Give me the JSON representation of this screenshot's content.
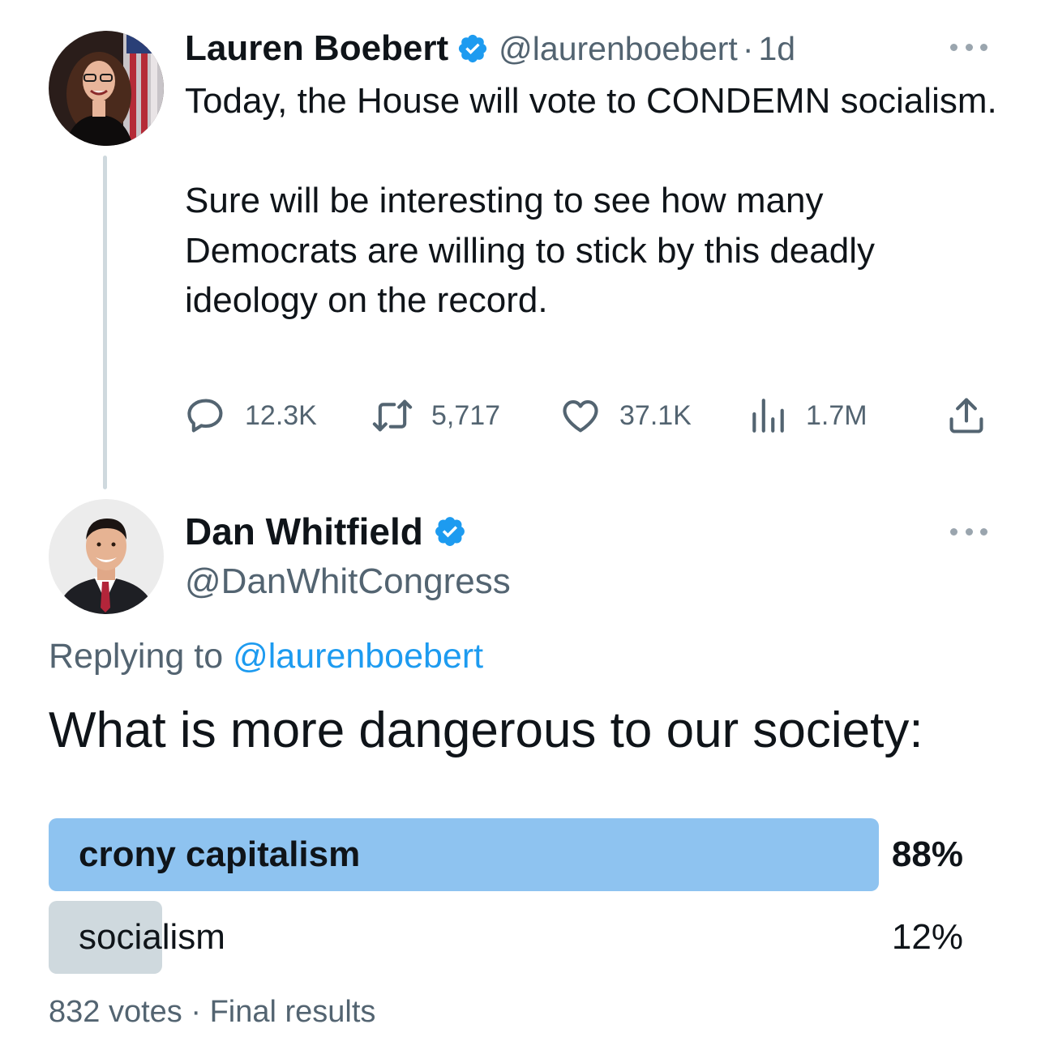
{
  "colors": {
    "verified": "#1d9bf0",
    "secondary_text": "#536471",
    "link": "#1d9bf0",
    "poll_winner": "#8ec3f0",
    "poll_other": "#cfd9de"
  },
  "original_tweet": {
    "author_name": "Lauren Boebert",
    "handle": "@laurenboebert",
    "separator": "·",
    "time": "1d",
    "text_lines": [
      "Today, the House will vote to CONDEMN socialism.",
      "",
      "Sure will be interesting to see how many Democrats are willing to stick by this deadly ideology on the record."
    ],
    "actions": {
      "replies": "12.3K",
      "retweets": "5,717",
      "likes": "37.1K",
      "views": "1.7M"
    },
    "icons": [
      "reply-icon",
      "retweet-icon",
      "like-icon",
      "views-icon",
      "share-icon",
      "more-icon",
      "verified-badge-icon"
    ]
  },
  "reply_tweet": {
    "author_name": "Dan Whitfield",
    "handle": "@DanWhitCongress",
    "replying_prefix": "Replying to ",
    "replying_to": "@laurenboebert",
    "question": "What is more dangerous to our society:",
    "poll": {
      "options": [
        {
          "label": "crony capitalism",
          "percent": 88,
          "percent_text": "88%",
          "winner": true
        },
        {
          "label": "socialism",
          "percent": 12,
          "percent_text": "12%",
          "winner": false
        }
      ],
      "votes": "832 votes",
      "separator": "·",
      "status": "Final results"
    }
  }
}
